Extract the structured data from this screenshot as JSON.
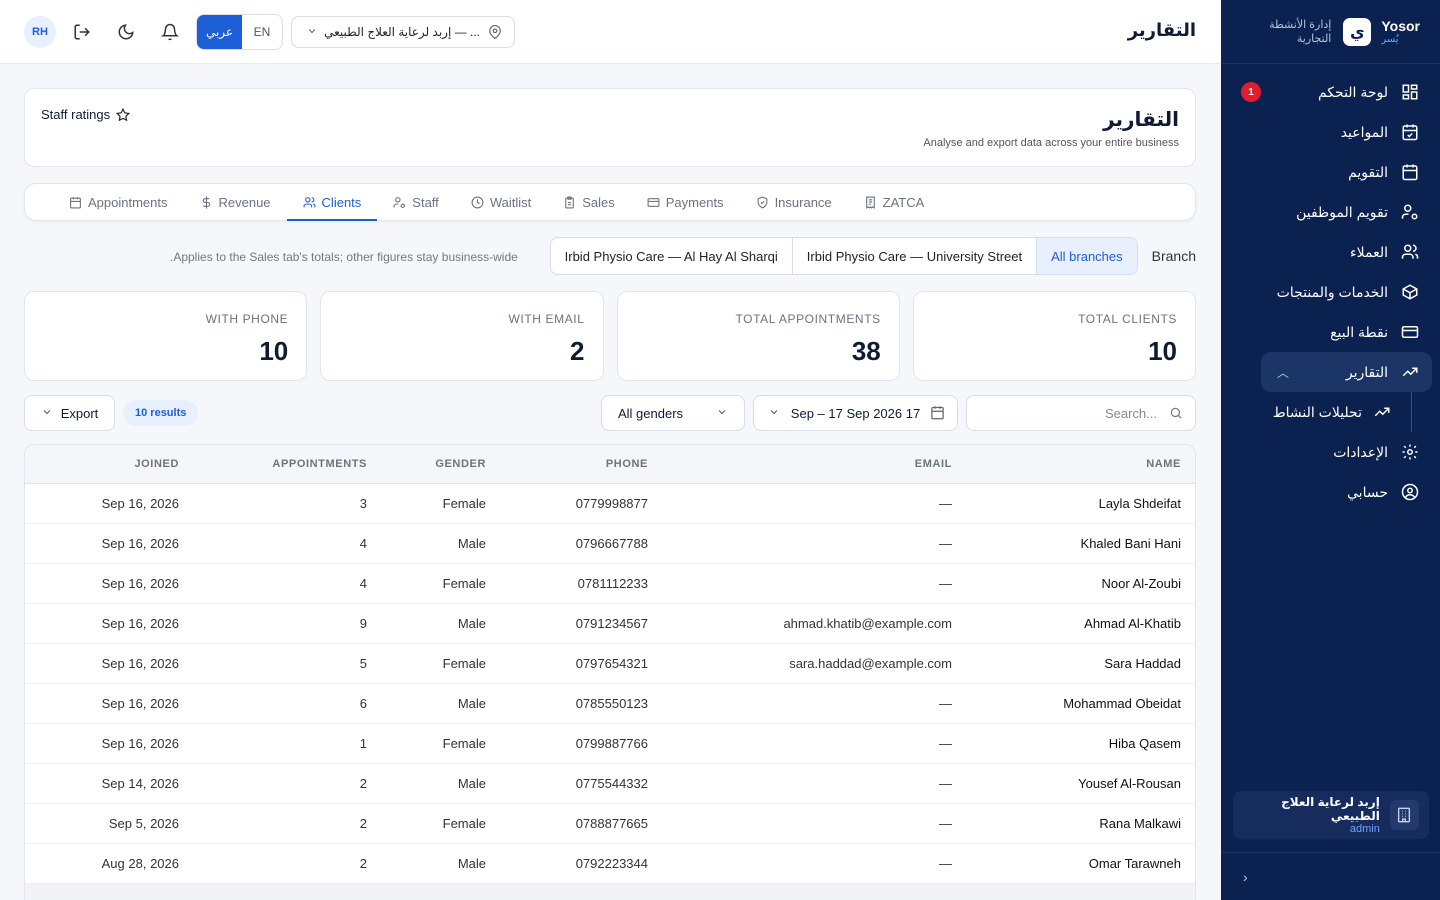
{
  "sidebar": {
    "brand_name": "Yosor",
    "brand_sub": "يُسر",
    "brand_logo": "ي",
    "brand_desc": "إدارة الأنشطة التجارية",
    "items": [
      {
        "label": "لوحة التحكم",
        "icon": "dashboard-icon",
        "badge": "1"
      },
      {
        "label": "المواعيد",
        "icon": "calendar-check-icon"
      },
      {
        "label": "التقويم",
        "icon": "calendar-icon"
      },
      {
        "label": "تقويم الموظفين",
        "icon": "user-cog-icon"
      },
      {
        "label": "العملاء",
        "icon": "users-icon"
      },
      {
        "label": "الخدمات والمنتجات",
        "icon": "box-icon"
      },
      {
        "label": "نقطة البيع",
        "icon": "credit-card-icon"
      },
      {
        "label": "التقارير",
        "icon": "trending-icon"
      },
      {
        "label": "تحليلات النشاط",
        "icon": "trending-icon"
      },
      {
        "label": "الإعدادات",
        "icon": "gear-icon"
      },
      {
        "label": "حسابي",
        "icon": "user-circle-icon"
      }
    ],
    "branch_name": "إربد لرعاية العلاج الطبيعي",
    "branch_role": "admin"
  },
  "topbar": {
    "title": "التقارير",
    "avatar": "RH",
    "lang_ar": "عربي",
    "lang_en": "EN",
    "branch_select": "إربد لرعاية العلاج الطبيعي — ..."
  },
  "header": {
    "title": "التقارير",
    "subtitle": "Analyse and export data across your entire business",
    "staff_ratings": "Staff ratings"
  },
  "tabs": [
    {
      "label": "Appointments"
    },
    {
      "label": "Revenue"
    },
    {
      "label": "Clients"
    },
    {
      "label": "Staff"
    },
    {
      "label": "Waitlist"
    },
    {
      "label": "Sales"
    },
    {
      "label": "Payments"
    },
    {
      "label": "Insurance"
    },
    {
      "label": "ZATCA"
    }
  ],
  "active_tab": "Clients",
  "branch_filter": {
    "note": ".Applies to the Sales tab's totals; other figures stay business-wide",
    "options": [
      "Irbid Physio Care — Al Hay Al Sharqi",
      "Irbid Physio Care — University Street",
      "All branches"
    ],
    "selected": "All branches",
    "label": "Branch"
  },
  "stats": [
    {
      "label": "WITH PHONE",
      "value": "10"
    },
    {
      "label": "WITH EMAIL",
      "value": "2"
    },
    {
      "label": "TOTAL APPOINTMENTS",
      "value": "38"
    },
    {
      "label": "TOTAL CLIENTS",
      "value": "10"
    }
  ],
  "filters": {
    "export_label": "Export",
    "results": "10 results",
    "gender": "All genders",
    "date_range": "Sep – 17 Sep 2026 17",
    "search_placeholder": "Search..."
  },
  "table": {
    "columns": [
      "JOINED",
      "APPOINTMENTS",
      "GENDER",
      "PHONE",
      "EMAIL",
      "NAME"
    ],
    "rows": [
      [
        "Sep 16, 2026",
        "3",
        "Female",
        "0779998877",
        "—",
        "Layla Shdeifat"
      ],
      [
        "Sep 16, 2026",
        "4",
        "Male",
        "0796667788",
        "—",
        "Khaled Bani Hani"
      ],
      [
        "Sep 16, 2026",
        "4",
        "Female",
        "0781112233",
        "—",
        "Noor Al-Zoubi"
      ],
      [
        "Sep 16, 2026",
        "9",
        "Male",
        "0791234567",
        "ahmad.khatib@example.com",
        "Ahmad Al-Khatib"
      ],
      [
        "Sep 16, 2026",
        "5",
        "Female",
        "0797654321",
        "sara.haddad@example.com",
        "Sara Haddad"
      ],
      [
        "Sep 16, 2026",
        "6",
        "Male",
        "0785550123",
        "—",
        "Mohammad Obeidat"
      ],
      [
        "Sep 16, 2026",
        "1",
        "Female",
        "0799887766",
        "—",
        "Hiba Qasem"
      ],
      [
        "Sep 14, 2026",
        "2",
        "Male",
        "0775544332",
        "—",
        "Yousef Al-Rousan"
      ],
      [
        "Sep 5, 2026",
        "2",
        "Female",
        "0788877665",
        "—",
        "Rana Malkawi"
      ],
      [
        "Aug 28, 2026",
        "2",
        "Male",
        "0792223344",
        "—",
        "Omar Tarawneh"
      ]
    ]
  },
  "colors": {
    "primary": "#1d5fd6",
    "sidebar": "#0b2150",
    "badge": "#e11d2e"
  }
}
